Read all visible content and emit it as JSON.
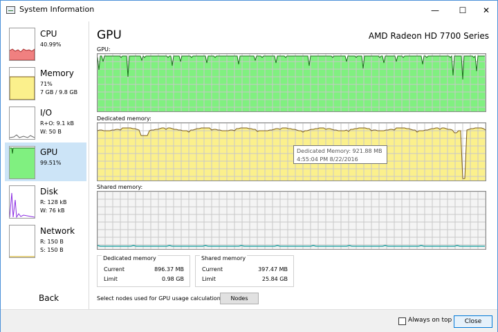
{
  "window": {
    "title": "System Information",
    "minimize": "—",
    "maximize": "☐",
    "close": "✕"
  },
  "sidebar": {
    "items": [
      {
        "name": "CPU",
        "line1": "40.99%",
        "line2": ""
      },
      {
        "name": "Memory",
        "line1": "71%",
        "line2": "7 GB / 9.8 GB"
      },
      {
        "name": "I/O",
        "line1": "R+O: 9.1 kB",
        "line2": "W: 50 B"
      },
      {
        "name": "GPU",
        "line1": "99.51%",
        "line2": ""
      },
      {
        "name": "Disk",
        "line1": "R: 128 kB",
        "line2": "W: 76 kB"
      },
      {
        "name": "Network",
        "line1": "R: 150 B",
        "line2": "S: 150 B"
      }
    ],
    "back_label": "Back"
  },
  "main": {
    "heading": "GPU",
    "device": "AMD Radeon HD 7700 Series",
    "graphs": {
      "gpu_label": "GPU:",
      "dedicated_label": "Dedicated memory:",
      "shared_label": "Shared memory:"
    },
    "tooltip": {
      "line1": "Dedicated Memory: 921.88 MB",
      "line2": "4:55:04 PM 8/22/2016"
    },
    "dedicated_box": {
      "title": "Dedicated memory",
      "current_label": "Current",
      "current_value": "896.37 MB",
      "limit_label": "Limit",
      "limit_value": "0.98 GB"
    },
    "shared_box": {
      "title": "Shared memory",
      "current_label": "Current",
      "current_value": "397.47 MB",
      "limit_label": "Limit",
      "limit_value": "25.84 GB"
    },
    "nodes_prompt": "Select nodes used for GPU usage calculations:",
    "nodes_button": "Nodes"
  },
  "footer": {
    "always_on_top": "Always on top",
    "close_button": "Close"
  },
  "colors": {
    "gpu_fill": "#80f080",
    "gpu_line": "#1a6e1a",
    "mem_fill": "#fbf08c",
    "mem_line": "#7a5a1a",
    "shared_line": "#2aa6a6",
    "grid": "#c8c8c8",
    "cpu_fill": "#f08080",
    "selected": "#cce4f7"
  }
}
